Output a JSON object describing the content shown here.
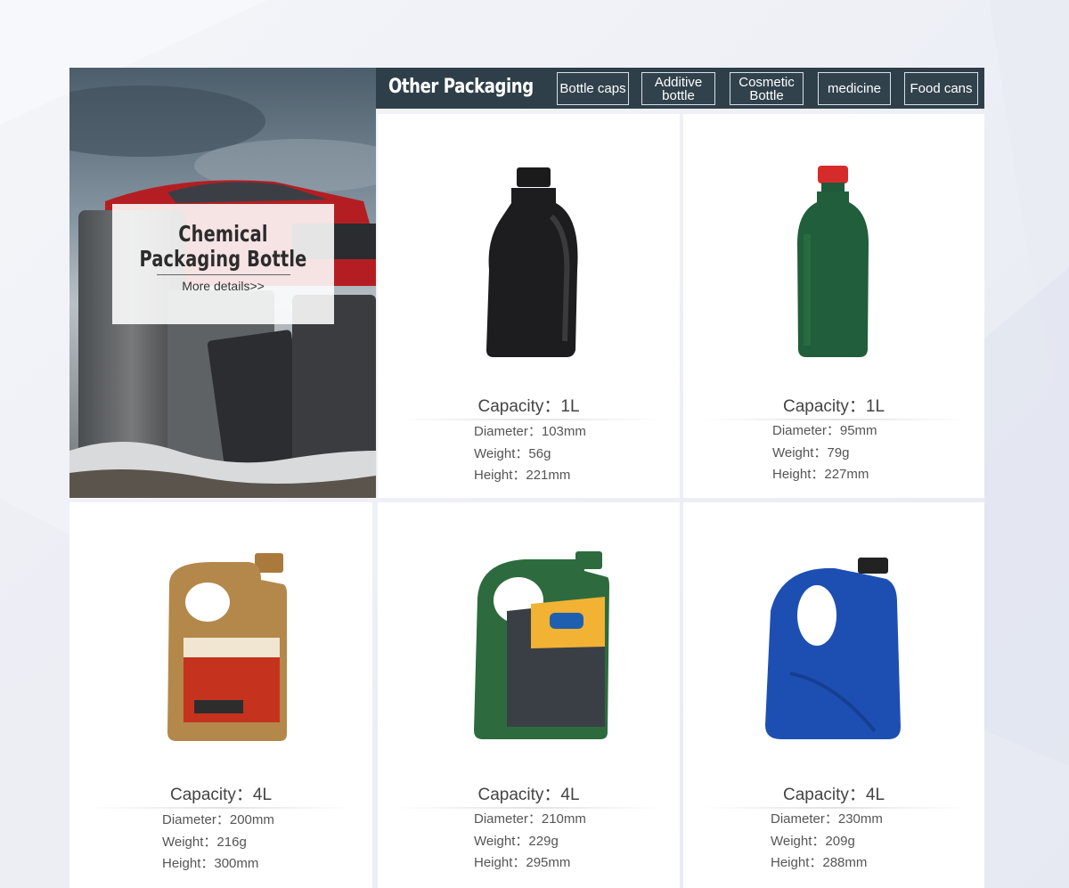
{
  "hero": {
    "title_line1": "Chemical",
    "title_line2": "Packaging Bottle",
    "more_link": "More details>>"
  },
  "header": {
    "title": "Other Packaging",
    "tabs": [
      {
        "label": "Bottle caps"
      },
      {
        "label": "Additive bottle"
      },
      {
        "label": "Cosmetic Bottle"
      },
      {
        "label": "medicine"
      },
      {
        "label": "Food cans"
      }
    ]
  },
  "products": [
    {
      "capacity": "Capacity：1L",
      "diameter": "Diameter：103mm",
      "weight": "Weight：56g",
      "height": "Height：221mm",
      "bottle_color": "#1a1a1a",
      "cap_color": "#111111",
      "shape": "oil-1l"
    },
    {
      "capacity": "Capacity：1L",
      "diameter": "Diameter：95mm",
      "weight": "Weight：79g",
      "height": "Height：227mm",
      "bottle_color": "#1f5a3a",
      "cap_color": "#d42a2a",
      "shape": "round-1l"
    },
    {
      "capacity": "Capacity：4L",
      "diameter": "Diameter：200mm",
      "weight": "Weight：216g",
      "height": "Height：300mm",
      "bottle_color": "#b4884b",
      "cap_color": "#a97a3c",
      "shape": "jug-4l"
    },
    {
      "capacity": "Capacity：4L",
      "diameter": "Diameter：210mm",
      "weight": "Weight：229g",
      "height": "Height：295mm",
      "bottle_color": "#2d6b3e",
      "cap_color": "#2d6b3e",
      "shape": "jug-4l"
    },
    {
      "capacity": "Capacity：4L",
      "diameter": "Diameter：230mm",
      "weight": "Weight：209g",
      "height": "Height：288mm",
      "bottle_color": "#1d4fb3",
      "cap_color": "#222222",
      "shape": "jug-4l"
    }
  ]
}
